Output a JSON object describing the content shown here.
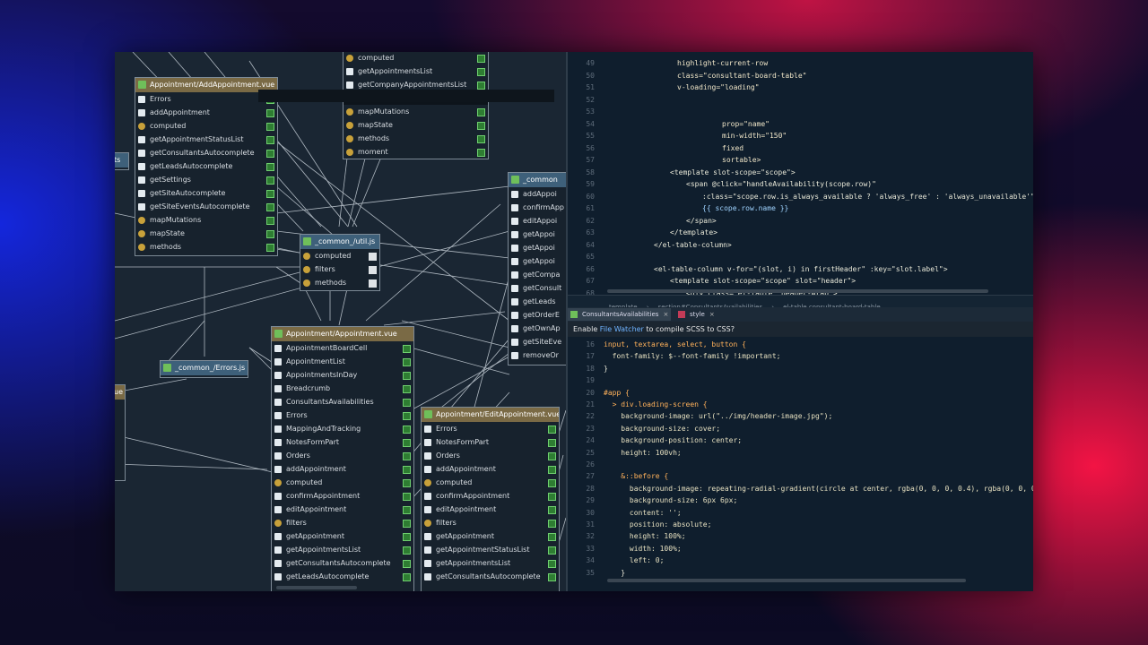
{
  "diagram": {
    "boxes": [
      {
        "id": "add",
        "title": "Appointment/AddAppointment.vue",
        "rows": [
          "Errors",
          "addAppointment",
          "computed",
          "getAppointmentStatusList",
          "getConsultantsAutocomplete",
          "getLeadsAutocomplete",
          "getSettings",
          "getSiteAutocomplete",
          "getSiteEventsAutocomplete",
          "mapMutations",
          "mapState",
          "methods"
        ]
      },
      {
        "id": "top",
        "title": "",
        "rows": [
          "computed",
          "getAppointmentsList",
          "getCompanyAppointmentsList",
          "",
          "mapMutations",
          "mapState",
          "methods",
          "moment"
        ]
      },
      {
        "id": "util",
        "title": "_common_/util.js",
        "rows": [
          "computed",
          "filters",
          "methods"
        ]
      },
      {
        "id": "errors",
        "title": "_common_/Errors.js",
        "rows": []
      },
      {
        "id": "ts",
        "title": "ts",
        "rows": []
      },
      {
        "id": "ue",
        "title": "ue",
        "rows": [
          "",
          "",
          "",
          "",
          ""
        ]
      },
      {
        "id": "appt",
        "title": "Appointment/Appointment.vue",
        "rows": [
          "AppointmentBoardCell",
          "AppointmentList",
          "AppointmentsInDay",
          "Breadcrumb",
          "ConsultantsAvailabilities",
          "Errors",
          "MappingAndTracking",
          "NotesFormPart",
          "Orders",
          "addAppointment",
          "computed",
          "confirmAppointment",
          "editAppointment",
          "filters",
          "getAppointment",
          "getAppointmentsList",
          "getConsultantsAutocomplete",
          "getLeadsAutocomplete"
        ]
      },
      {
        "id": "edit",
        "title": "Appointment/EditAppointment.vue",
        "rows": [
          "Errors",
          "NotesFormPart",
          "Orders",
          "addAppointment",
          "computed",
          "confirmAppointment",
          "editAppointment",
          "filters",
          "getAppointment",
          "getAppointmentStatusList",
          "getAppointmentsList",
          "getConsultantsAutocomplete"
        ]
      },
      {
        "id": "common",
        "title": "_common",
        "rows": [
          "addAppoi",
          "confirmApp",
          "editAppoi",
          "getAppoi",
          "getAppoi",
          "getAppoi",
          "getCompa",
          "getConsult",
          "getLeads",
          "getOrderE",
          "getOwnAp",
          "getSiteEve",
          "removeOr"
        ]
      }
    ]
  },
  "editor_top": {
    "lines": [
      {
        "n": "49",
        "t": "highlight-current-row"
      },
      {
        "n": "50",
        "t": "class=\"consultant-board-table\""
      },
      {
        "n": "51",
        "t": "v-loading=\"loading\""
      },
      {
        "n": "52",
        "t": ""
      },
      {
        "n": "53",
        "t": ""
      },
      {
        "n": "54",
        "t": "prop=\"name\""
      },
      {
        "n": "55",
        "t": "min-width=\"150\""
      },
      {
        "n": "56",
        "t": "fixed"
      },
      {
        "n": "57",
        "t": "sortable>"
      },
      {
        "n": "58",
        "t": "<template slot-scope=\"scope\">"
      },
      {
        "n": "59",
        "t": "<span @click=\"handleAvailability(scope.row)\""
      },
      {
        "n": "60",
        "t": ":class=\"scope.row.is_always_available ? 'always_free' : 'always_unavailable'\">"
      },
      {
        "n": "61",
        "t": "{{ scope.row.name }}"
      },
      {
        "n": "62",
        "t": "</span>"
      },
      {
        "n": "63",
        "t": "</template>"
      },
      {
        "n": "64",
        "t": "</el-table-column>"
      },
      {
        "n": "65",
        "t": ""
      },
      {
        "n": "66",
        "t": "<el-table-column v-for=\"(slot, i) in firstHeader\" :key=\"slot.label\">"
      },
      {
        "n": "67",
        "t": "<template slot-scope=\"scope\" slot=\"header\">"
      },
      {
        "n": "68",
        "t": "<div class=\"el-table__header-wrap\">"
      }
    ]
  },
  "breadcrumb": [
    "template",
    "section#ConsultantsAvailabilities",
    "el-table.consultant-board-table"
  ],
  "tabs": [
    {
      "label": "ConsultantsAvailabilities",
      "active": true
    },
    {
      "label": "style",
      "active": false
    }
  ],
  "notice": {
    "pre": "Enable ",
    "link": "File Watcher",
    "post": " to compile SCSS to CSS?"
  },
  "editor_bottom": {
    "lines": [
      {
        "n": "16",
        "t": "input, textarea, select, button {"
      },
      {
        "n": "17",
        "t": "  font-family: $--font-family !important;"
      },
      {
        "n": "18",
        "t": "}"
      },
      {
        "n": "19",
        "t": ""
      },
      {
        "n": "20",
        "t": "#app {"
      },
      {
        "n": "21",
        "t": "  > div.loading-screen {"
      },
      {
        "n": "22",
        "t": "    background-image: url(\"../img/header-image.jpg\");"
      },
      {
        "n": "23",
        "t": "    background-size: cover;"
      },
      {
        "n": "24",
        "t": "    background-position: center;"
      },
      {
        "n": "25",
        "t": "    height: 100vh;"
      },
      {
        "n": "26",
        "t": ""
      },
      {
        "n": "27",
        "t": "    &::before {"
      },
      {
        "n": "28",
        "t": "      background-image: repeating-radial-gradient(circle at center, rgba(0, 0, 0, 0.4), rgba(0, 0, 0, 0.4"
      },
      {
        "n": "29",
        "t": "      background-size: 6px 6px;"
      },
      {
        "n": "30",
        "t": "      content: '';"
      },
      {
        "n": "31",
        "t": "      position: absolute;"
      },
      {
        "n": "32",
        "t": "      height: 100%;"
      },
      {
        "n": "33",
        "t": "      width: 100%;"
      },
      {
        "n": "34",
        "t": "      left: 0;"
      },
      {
        "n": "35",
        "t": "    }"
      }
    ]
  }
}
